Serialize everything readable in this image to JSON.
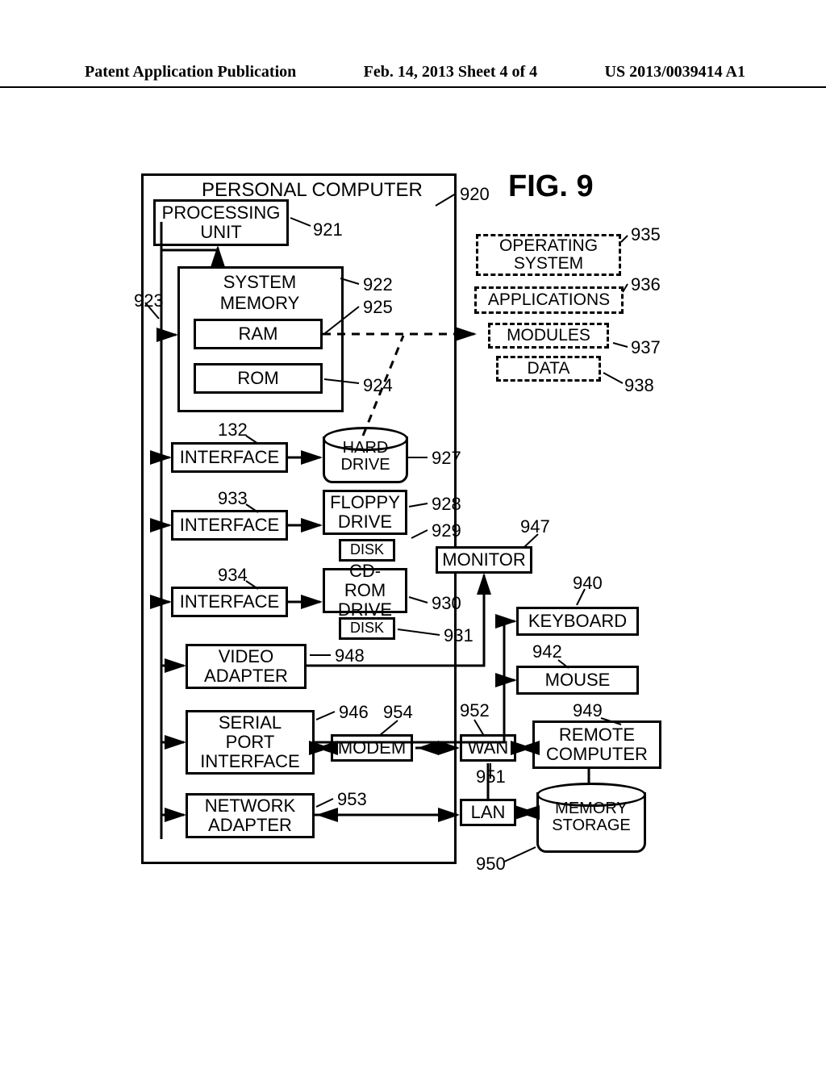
{
  "header": {
    "left": "Patent Application Publication",
    "center": "Feb. 14, 2013  Sheet 4 of 4",
    "right": "US 2013/0039414 A1"
  },
  "figure_title": "FIG. 9",
  "labels": {
    "pc": "PERSONAL COMPUTER",
    "pu": "PROCESSING\nUNIT",
    "sm": "SYSTEM\nMEMORY",
    "ram": "RAM",
    "rom": "ROM",
    "interface": "INTERFACE",
    "hd": "HARD\nDRIVE",
    "fd": "FLOPPY\nDRIVE",
    "cd": "CD-ROM\nDRIVE",
    "disk": "DISK",
    "va": "VIDEO\nADAPTER",
    "sp": "SERIAL\nPORT\nINTERFACE",
    "na": "NETWORK\nADAPTER",
    "modem": "MODEM",
    "wan": "WAN",
    "lan": "LAN",
    "monitor": "MONITOR",
    "keyboard": "KEYBOARD",
    "mouse": "MOUSE",
    "remote": "REMOTE\nCOMPUTER",
    "mem": "MEMORY\nSTORAGE",
    "os": "OPERATING\nSYSTEM",
    "apps": "APPLICATIONS",
    "mods": "MODULES",
    "data": "DATA"
  },
  "refs": {
    "920": "920",
    "921": "921",
    "922": "922",
    "923": "923",
    "924": "924",
    "925": "925",
    "927": "927",
    "928": "928",
    "929": "929",
    "930": "930",
    "931": "931",
    "132": "132",
    "933": "933",
    "934": "934",
    "935": "935",
    "936": "936",
    "937": "937",
    "938": "938",
    "940": "940",
    "942": "942",
    "946": "946",
    "947": "947",
    "948": "948",
    "949": "949",
    "950": "950",
    "951": "951",
    "952": "952",
    "953": "953",
    "954": "954"
  }
}
